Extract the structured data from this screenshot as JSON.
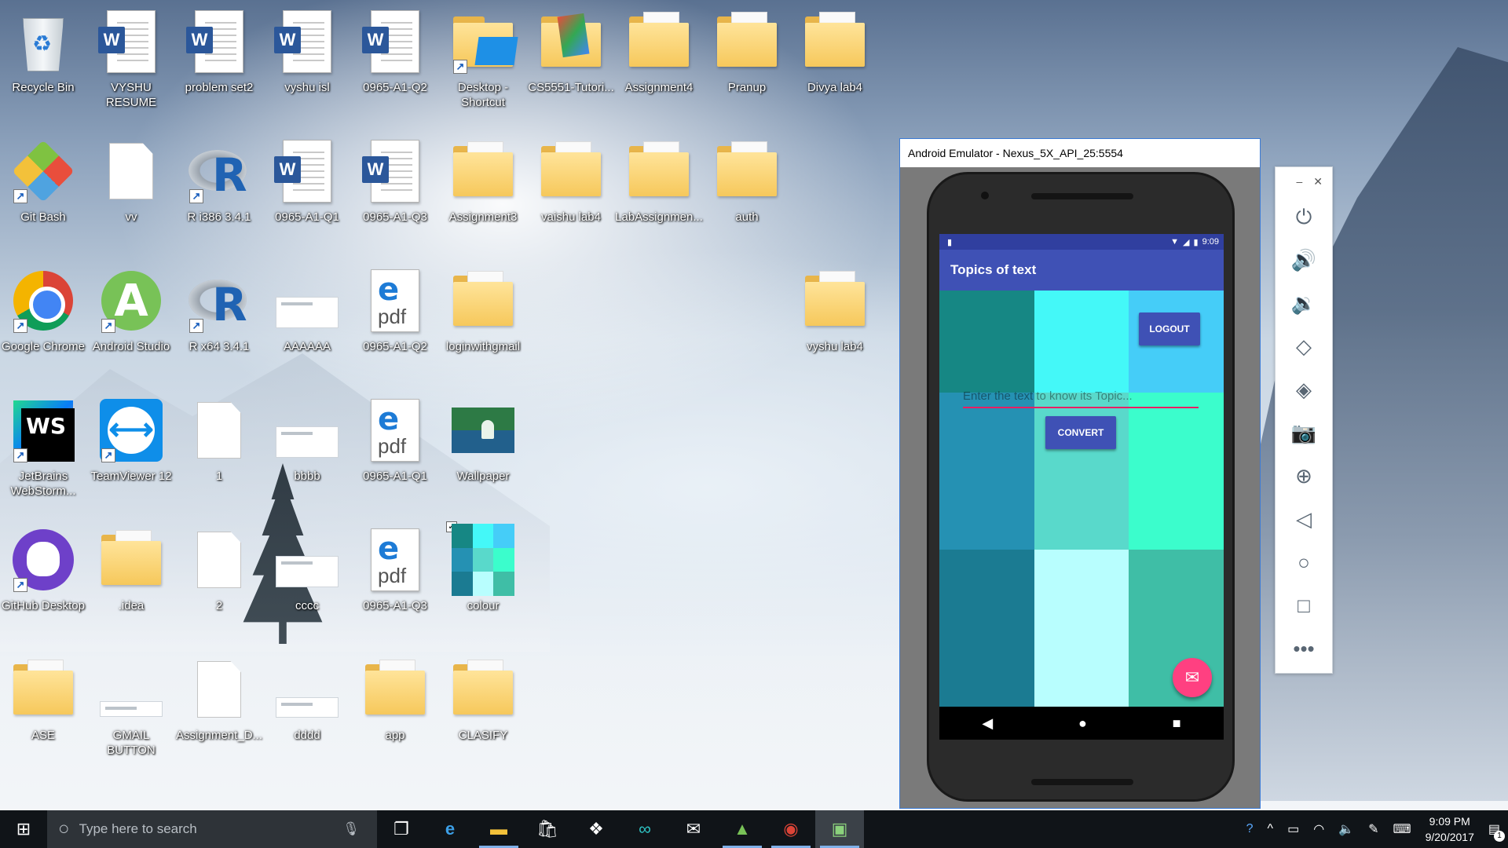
{
  "desktop": {
    "icons": [
      {
        "label": "Recycle Bin"
      },
      {
        "label": "VYSHU RESUME"
      },
      {
        "label": "problem set2"
      },
      {
        "label": "vyshu isl"
      },
      {
        "label": "0965-A1-Q2"
      },
      {
        "label": "Desktop - Shortcut"
      },
      {
        "label": "CS5551-Tutori..."
      },
      {
        "label": "Assignment4"
      },
      {
        "label": "Pranup"
      },
      {
        "label": "Divya lab4"
      },
      {
        "label": "Git Bash"
      },
      {
        "label": "vv"
      },
      {
        "label": "R i386 3.4.1"
      },
      {
        "label": "0965-A1-Q1"
      },
      {
        "label": "0965-A1-Q3"
      },
      {
        "label": "Assignment3"
      },
      {
        "label": "vaishu lab4"
      },
      {
        "label": "LabAssignmen..."
      },
      {
        "label": "auth"
      },
      {
        "label": "Google Chrome"
      },
      {
        "label": "Android Studio"
      },
      {
        "label": "R x64 3.4.1"
      },
      {
        "label": "AAAAAA"
      },
      {
        "label": "0965-A1-Q2"
      },
      {
        "label": "loginwithgmail"
      },
      {
        "label": "vyshu lab4"
      },
      {
        "label": "JetBrains WebStorm..."
      },
      {
        "label": "TeamViewer 12"
      },
      {
        "label": "1"
      },
      {
        "label": "bbbb"
      },
      {
        "label": "0965-A1-Q1"
      },
      {
        "label": "Wallpaper"
      },
      {
        "label": "GitHub Desktop"
      },
      {
        "label": ".idea"
      },
      {
        "label": "2"
      },
      {
        "label": "cccc"
      },
      {
        "label": "0965-A1-Q3"
      },
      {
        "label": "colour"
      },
      {
        "label": "ASE"
      },
      {
        "label": "GMAIL BUTTON"
      },
      {
        "label": "Assignment_D..."
      },
      {
        "label": "dddd"
      },
      {
        "label": "app"
      },
      {
        "label": "CLASIFY"
      }
    ]
  },
  "emulator": {
    "window_title": "Android Emulator - Nexus_5X_API_25:5554",
    "status_time": "9:09",
    "app_title": "Topics of text",
    "logout_label": "LOGOUT",
    "input_placeholder": "Enter the text to know its Topic...",
    "convert_label": "CONVERT",
    "tile_colors": [
      "#168784",
      "#44f8f8",
      "#45cdf8",
      "#2591b3",
      "#59d9cb",
      "#3bfdcc",
      "#1b7b92",
      "#b8fefe",
      "#3fbea6"
    ],
    "accent_color": "#ff4081",
    "primary_color": "#3f51b5"
  },
  "emulator_toolbar": {
    "minimize": "–",
    "close": "✕",
    "buttons": [
      "power",
      "volume-up",
      "volume-down",
      "rotate-left",
      "rotate-right",
      "screenshot",
      "zoom",
      "back",
      "home",
      "overview",
      "more"
    ]
  },
  "taskbar": {
    "search_placeholder": "Type here to search",
    "time": "9:09 PM",
    "date": "9/20/2017",
    "notification_count": "1"
  }
}
